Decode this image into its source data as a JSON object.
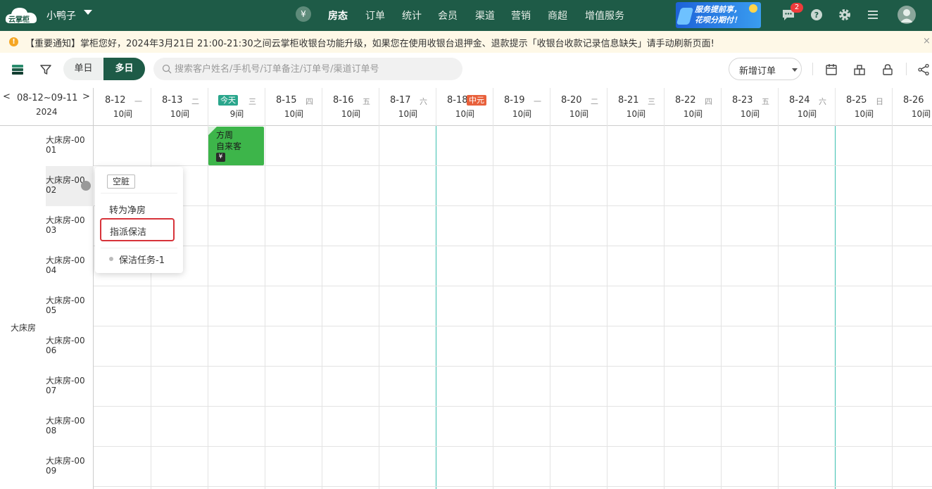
{
  "app": {
    "logo_text": "云掌柜",
    "store_name": "小鸭子"
  },
  "nav": {
    "items": [
      {
        "label": "房态",
        "active": true
      },
      {
        "label": "订单"
      },
      {
        "label": "统计"
      },
      {
        "label": "会员"
      },
      {
        "label": "渠道"
      },
      {
        "label": "营销"
      },
      {
        "label": "商超"
      },
      {
        "label": "增值服务"
      }
    ],
    "currency_icon": "¥",
    "promo_line1": "服务提前享，",
    "promo_line2": "花呗分期付！",
    "message_count": "2",
    "brand_color": "#1e5b47"
  },
  "notice": {
    "icon": "!",
    "text": "【重要通知】掌柜您好，2024年3月21日 21:00-21:30之间云掌柜收银台功能升级，如果您在使用收银台退押金、退款提示「收银台收款记录信息缺失」请手动刷新页面!",
    "close_icon": "×"
  },
  "toolbar": {
    "single_day": "单日",
    "multi_day": "多日",
    "search_placeholder": "搜索客户姓名/手机号/订单备注/订单号/渠道订单号",
    "search_value": "",
    "new_order": "新增订单"
  },
  "date_range": {
    "prev": "<",
    "text": "08-12~09-11",
    "next": ">",
    "year": "2024"
  },
  "days": [
    {
      "date": "8-12",
      "week": "一",
      "rooms": "10间"
    },
    {
      "date": "8-13",
      "week": "二",
      "rooms": "10间"
    },
    {
      "date": "",
      "week": "三",
      "rooms": "9间",
      "tag": "今天",
      "tag_color": "#2aa68c"
    },
    {
      "date": "8-15",
      "week": "四",
      "rooms": "10间"
    },
    {
      "date": "8-16",
      "week": "五",
      "rooms": "10间"
    },
    {
      "date": "8-17",
      "week": "六",
      "rooms": "10间"
    },
    {
      "date": "8-18",
      "week": "",
      "rooms": "10间",
      "tag": "中元",
      "tag_color": "#e8613c"
    },
    {
      "date": "8-19",
      "week": "一",
      "rooms": "10间"
    },
    {
      "date": "8-20",
      "week": "二",
      "rooms": "10间"
    },
    {
      "date": "8-21",
      "week": "三",
      "rooms": "10间"
    },
    {
      "date": "8-22",
      "week": "四",
      "rooms": "10间"
    },
    {
      "date": "8-23",
      "week": "五",
      "rooms": "10间"
    },
    {
      "date": "8-24",
      "week": "六",
      "rooms": "10间"
    },
    {
      "date": "8-25",
      "week": "日",
      "rooms": "10间"
    },
    {
      "date": "8-26",
      "week": "一",
      "rooms": "10间"
    }
  ],
  "room_type": "大床房",
  "rooms": [
    "大床房-0001",
    "大床房-0002",
    "大床房-0003",
    "大床房-0004",
    "大床房-0005",
    "大床房-0006",
    "大床房-0007",
    "大床房-0008",
    "大床房-0009"
  ],
  "booking": {
    "name": "方周",
    "source": "自来客",
    "pay_icon": "¥",
    "color": "#3db54a"
  },
  "popup": {
    "status": "空脏",
    "clean_action": "转为净房",
    "assign_action": "指派保洁",
    "task": "保洁任务-1"
  }
}
